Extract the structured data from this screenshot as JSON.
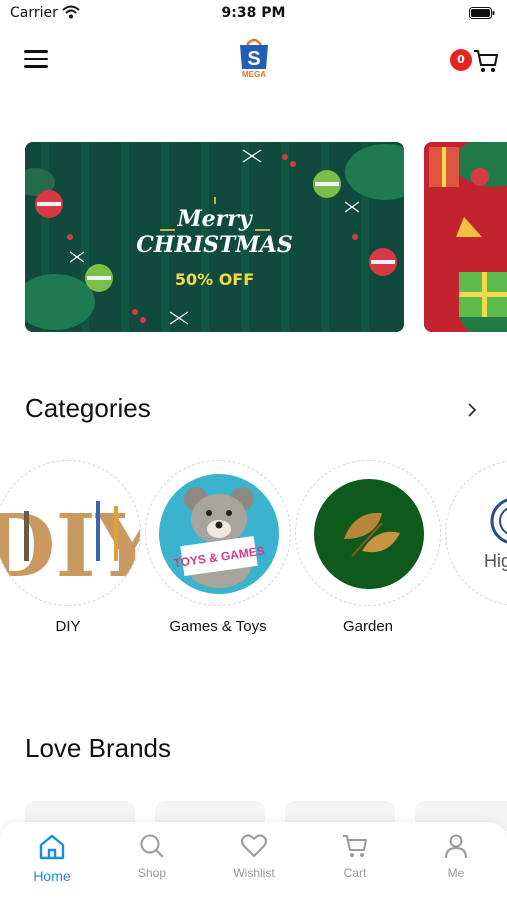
{
  "status_bar": {
    "carrier": "Carrier",
    "time": "9:38 PM"
  },
  "header": {
    "logo_text": "MEGA",
    "cart_count": "0"
  },
  "banners": {
    "main": {
      "line1": "Merry",
      "line2": "CHRISTMAS",
      "offer": "50% OFF"
    }
  },
  "categories": {
    "title": "Categories",
    "items": [
      {
        "label": "DIY",
        "image_text": "DIY"
      },
      {
        "label": "Games & Toys",
        "image_text": "TOYS & GAMES"
      },
      {
        "label": "Garden",
        "image_text": ""
      },
      {
        "label": "Hig",
        "image_text": "Hig"
      }
    ]
  },
  "brands": {
    "title": "Love Brands"
  },
  "bottom_nav": {
    "items": [
      {
        "label": "Home",
        "icon": "home-icon",
        "active": true
      },
      {
        "label": "Shop",
        "icon": "search-icon",
        "active": false
      },
      {
        "label": "Wishlist",
        "icon": "heart-icon",
        "active": false
      },
      {
        "label": "Cart",
        "icon": "cart-icon",
        "active": false
      },
      {
        "label": "Me",
        "icon": "user-icon",
        "active": false
      }
    ]
  },
  "colors": {
    "accent": "#1d8be6",
    "badge": "#e8231f",
    "banner_green": "#0f4a3c"
  }
}
